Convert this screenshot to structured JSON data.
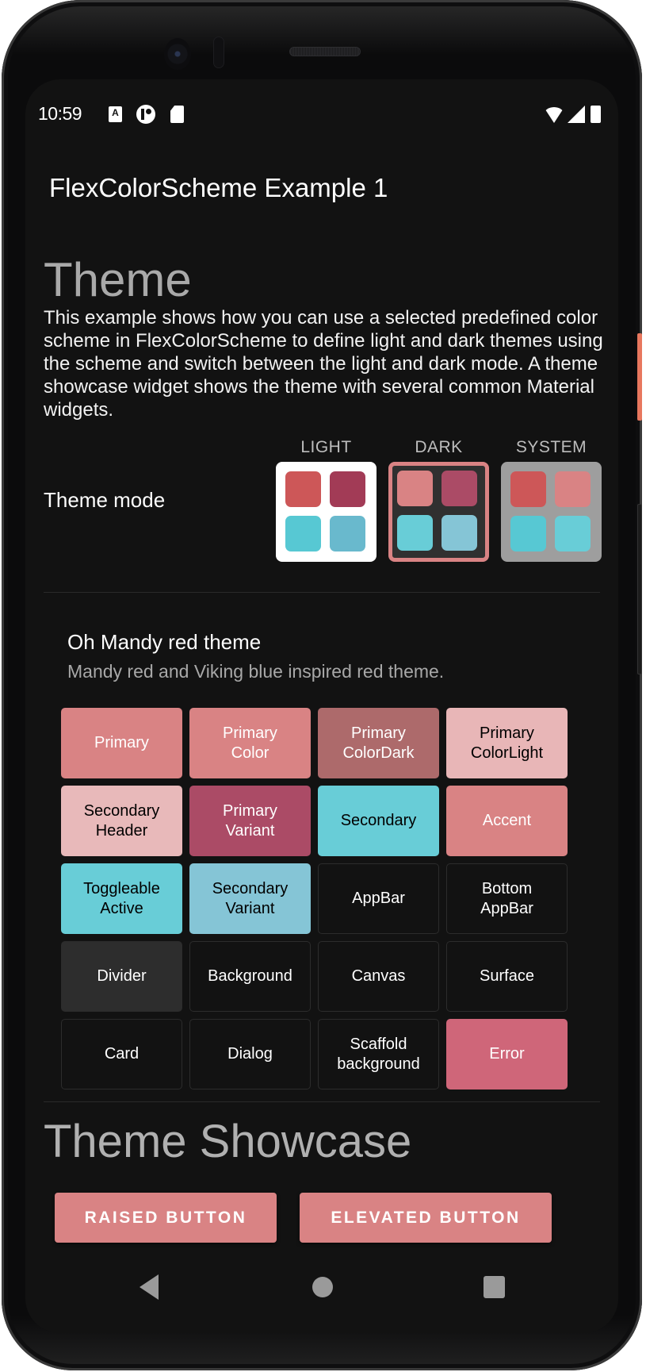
{
  "status_bar": {
    "time": "10:59",
    "left_icons": [
      "accessibility-a-icon",
      "p-circle-icon",
      "sd-card-icon"
    ],
    "right_icons": [
      "wifi-icon",
      "cell-signal-icon",
      "battery-icon"
    ],
    "a_glyph": "A"
  },
  "app_bar": {
    "title": "FlexColorScheme Example 1"
  },
  "theme_section": {
    "heading": "Theme",
    "description": "This example shows how you can use a selected predefined color scheme in FlexColorScheme to define light and dark themes using the scheme and switch between the light and dark mode. A theme showcase widget shows the theme with several common Material widgets."
  },
  "theme_mode": {
    "label": "Theme mode",
    "selected": "DARK",
    "options": [
      {
        "label": "LIGHT",
        "background": "#ffffff",
        "swatches": [
          "#cd5758",
          "#a23b56",
          "#57c8d3",
          "#69b9cd"
        ]
      },
      {
        "label": "DARK",
        "background": "#303030",
        "border": "#d98384",
        "swatches": [
          "#d98384",
          "#ab4b66",
          "#68cdd7",
          "#85c5d6"
        ]
      },
      {
        "label": "SYSTEM",
        "background": "#9e9e9e",
        "swatches": [
          "#cd5758",
          "#d98384",
          "#57c8d3",
          "#68cdd7"
        ]
      }
    ]
  },
  "scheme": {
    "name": "Oh Mandy red theme",
    "description": "Mandy red and Viking blue inspired red theme.",
    "tiles": [
      {
        "label": "Primary",
        "bg": "#d98384",
        "fg": "#ffffff"
      },
      {
        "label": "Primary\nColor",
        "bg": "#d98384",
        "fg": "#ffffff"
      },
      {
        "label": "Primary\nColorDark",
        "bg": "#ad6a6b",
        "fg": "#ffffff"
      },
      {
        "label": "Primary\nColorLight",
        "bg": "#e8b6b7",
        "fg": "#000000"
      },
      {
        "label": "Secondary\nHeader",
        "bg": "#e8b9ba",
        "fg": "#000000"
      },
      {
        "label": "Primary\nVariant",
        "bg": "#ab4b66",
        "fg": "#ffffff"
      },
      {
        "label": "Secondary",
        "bg": "#68cdd7",
        "fg": "#000000"
      },
      {
        "label": "Accent",
        "bg": "#d98384",
        "fg": "#ffffff"
      },
      {
        "label": "Toggleable\nActive",
        "bg": "#68cdd7",
        "fg": "#000000"
      },
      {
        "label": "Secondary\nVariant",
        "bg": "#85c5d6",
        "fg": "#000000"
      },
      {
        "label": "AppBar",
        "bg": "#121212",
        "fg": "#ffffff",
        "outlined": true
      },
      {
        "label": "Bottom\nAppBar",
        "bg": "#121212",
        "fg": "#ffffff",
        "outlined": true
      },
      {
        "label": "Divider",
        "bg": "#2d2d2d",
        "fg": "#ffffff",
        "outlined": true
      },
      {
        "label": "Background",
        "bg": "#121212",
        "fg": "#ffffff",
        "outlined": true
      },
      {
        "label": "Canvas",
        "bg": "#121212",
        "fg": "#ffffff",
        "outlined": true
      },
      {
        "label": "Surface",
        "bg": "#121212",
        "fg": "#ffffff",
        "outlined": true
      },
      {
        "label": "Card",
        "bg": "#121212",
        "fg": "#ffffff",
        "outlined": true
      },
      {
        "label": "Dialog",
        "bg": "#121212",
        "fg": "#ffffff",
        "outlined": true
      },
      {
        "label": "Scaffold\nbackground",
        "bg": "#121212",
        "fg": "#ffffff",
        "outlined": true
      },
      {
        "label": "Error",
        "bg": "#cf6679",
        "fg": "#ffffff"
      }
    ]
  },
  "showcase": {
    "heading": "Theme Showcase",
    "raised_button": "RAISED BUTTON",
    "elevated_button": "ELEVATED BUTTON"
  },
  "nav_bar": {
    "back": "back-icon",
    "home": "home-icon",
    "recents": "recents-icon"
  },
  "colors": {
    "background": "#121212",
    "primary": "#d98384",
    "secondary": "#68cdd7",
    "error": "#cf6679"
  }
}
